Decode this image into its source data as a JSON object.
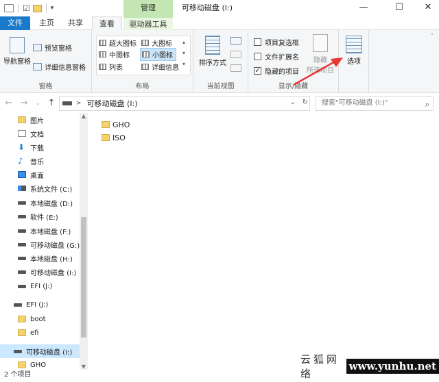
{
  "window": {
    "title": "可移动磁盘 (I:)",
    "context_tab": "管理",
    "controls": {
      "minimize": "—",
      "maximize": "☐",
      "close": "✕"
    }
  },
  "quick_access": {
    "dropdown": "▾"
  },
  "tabs": [
    "文件",
    "主页",
    "共享",
    "查看",
    "驱动器工具"
  ],
  "ribbon": {
    "panes": {
      "nav_pane": "导航窗格",
      "preview_pane": "预览窗格",
      "details_pane": "详细信息窗格",
      "label": "窗格"
    },
    "layout": {
      "items": [
        "超大图标",
        "大图标",
        "中图标",
        "小图标",
        "列表",
        "详细信息"
      ],
      "selected": "小图标",
      "label": "布局"
    },
    "current_view": {
      "sort": "排序方式",
      "label": "当前视图"
    },
    "show_hide": {
      "checkboxes": [
        {
          "label": "项目复选框",
          "checked": false
        },
        {
          "label": "文件扩展名",
          "checked": false
        },
        {
          "label": "隐藏的项目",
          "checked": true
        }
      ],
      "hide_selected_1": "隐藏",
      "hide_selected_2": "所选项目",
      "label": "显示/隐藏"
    },
    "options": "选项"
  },
  "address": {
    "path": "可移动磁盘 (I:)",
    "chevron": ">",
    "dropdown": "⌄",
    "refresh": "↻",
    "search_placeholder": "搜索\"可移动磁盘 (I:)\"",
    "search_icon": "search-icon"
  },
  "nav": {
    "back": "←",
    "forward": "→",
    "recent": "⌄",
    "up": "↑"
  },
  "sidebar": {
    "items": [
      {
        "label": "图片",
        "icon": "folder"
      },
      {
        "label": "文档",
        "icon": "doc"
      },
      {
        "label": "下载",
        "icon": "down"
      },
      {
        "label": "音乐",
        "icon": "music"
      },
      {
        "label": "桌面",
        "icon": "desk"
      },
      {
        "label": "系统文件 (C:)",
        "icon": "sys"
      },
      {
        "label": "本地磁盘 (D:)",
        "icon": "drive"
      },
      {
        "label": "软件 (E:)",
        "icon": "drive"
      },
      {
        "label": "本地磁盘 (F:)",
        "icon": "drive"
      },
      {
        "label": "可移动磁盘 (G:)",
        "icon": "drive"
      },
      {
        "label": "本地磁盘 (H:)",
        "icon": "drive"
      },
      {
        "label": "可移动磁盘 (I:)",
        "icon": "drive"
      },
      {
        "label": "EFI (J:)",
        "icon": "drive"
      },
      {
        "label": "EFI (J:)",
        "icon": "drive"
      },
      {
        "label": "boot",
        "icon": "folder"
      },
      {
        "label": "efi",
        "icon": "folder"
      },
      {
        "label": "可移动磁盘 (I:)",
        "icon": "drive"
      },
      {
        "label": "GHO",
        "icon": "folder"
      }
    ]
  },
  "files": [
    "GHO",
    "ISO"
  ],
  "status": {
    "count": "2 个项目"
  },
  "watermark": {
    "cn": "云狐网络",
    "url": "www.yunhu.net"
  },
  "colors": {
    "accent": "#1979ca",
    "selection": "#cce8ff",
    "arrow": "#e53935",
    "manage": "#c3e6b3"
  }
}
